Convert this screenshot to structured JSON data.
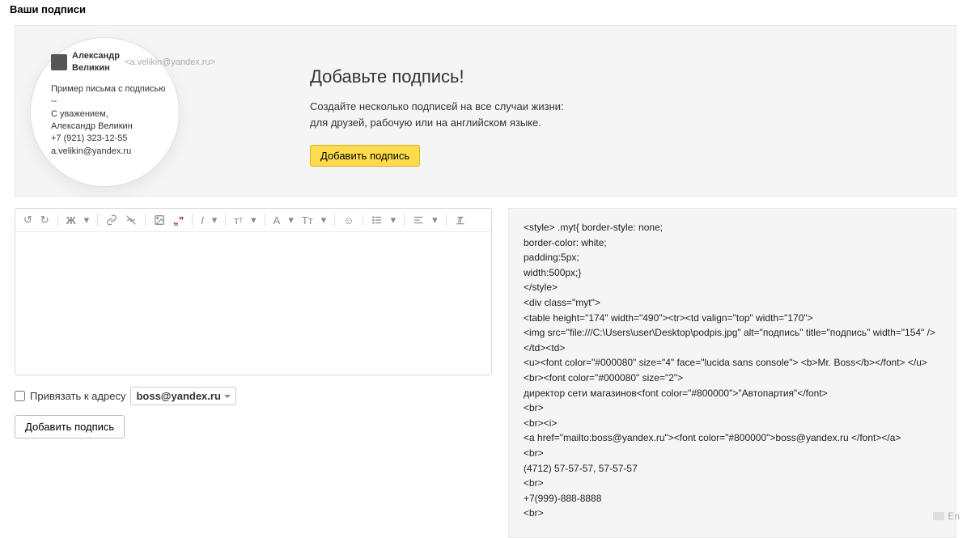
{
  "page_title": "Ваши подписи",
  "intro": {
    "preview": {
      "name": "Александр Великин",
      "email": "<a.velikin@yandex.ru>",
      "sample_title": "Пример письма с подписью",
      "divider": "--",
      "line1": "С уважением,",
      "line2": "Александр Великин",
      "line3": "+7 (921) 323-12-55",
      "line4": "a.velikin@yandex.ru"
    },
    "heading": "Добавьте подпись!",
    "desc1": "Создайте несколько подписей на все случаи жизни:",
    "desc2": "для друзей, рабочую или на английском языке.",
    "add_button": "Добавить подпись"
  },
  "editor": {
    "bind_label": "Привязать к адресу",
    "bind_value": "boss@yandex.ru",
    "submit_button": "Добавить подпись"
  },
  "code_panel": {
    "l1": "<style> .myt{ border-style: none;",
    "l2": "border-color: white;",
    "l3": "padding:5px;",
    "l4": "width:500px;}",
    "l5": "</style>",
    "l6": "<div class=\"myt\">",
    "l7": "<table height=\"174\" width=\"490\"><tr><td valign=\"top\" width=\"170\">",
    "l8": "<img src=\"file:///C:\\Users\\user\\Desktop\\podpis.jpg\" alt=\"подпись\" title=\"подпись\" width=\"154\" />",
    "l9": "</td><td>",
    "l10": "<u><font color=\"#000080\" size=\"4\" face=\"lucida sans console\"> <b>Mr. Boss</b></font> </u>",
    "l11": "<br><font color=\"#000080\" size=\"2\">",
    "l12": "директор сети магазинов<font color=\"#800000\">\"Автопартия\"</font>",
    "l13": "<br>",
    "l14": "<br><i>",
    "l15": "<a href=\"mailto:boss@yandex.ru\"><font color=\"#800000\">boss@yandex.ru </font></a>",
    "l16": "<br>",
    "l17": "(4712) 57-57-57, 57-57-57",
    "l18": "<br>",
    "l19": "+7(999)-888-8888",
    "l20": "<br>"
  },
  "lang": "En"
}
